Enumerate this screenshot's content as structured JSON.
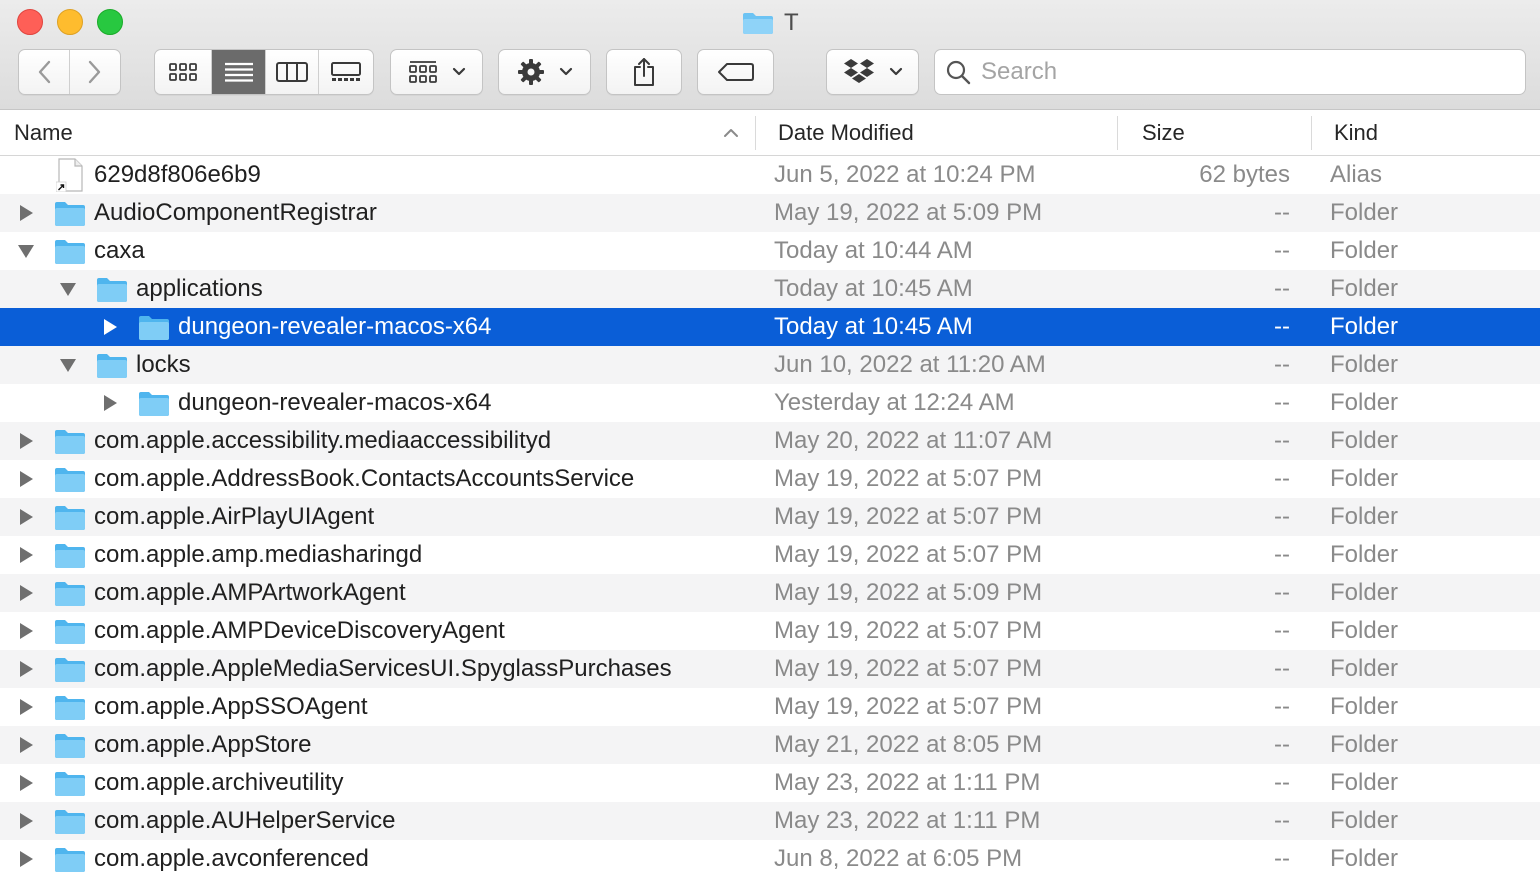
{
  "window": {
    "title": "T",
    "title_icon": "folder-icon"
  },
  "toolbar": {
    "back_icon": "chevron-left-icon",
    "forward_icon": "chevron-right-icon",
    "view_modes": [
      "icon-view-icon",
      "list-view-icon",
      "column-view-icon",
      "gallery-view-icon"
    ],
    "active_view": "list",
    "group_icon": "group-grid-icon",
    "action_icon": "gear-icon",
    "share_icon": "share-icon",
    "tag_icon": "tag-icon",
    "dropbox_icon": "dropbox-icon"
  },
  "search": {
    "placeholder": "Search",
    "value": ""
  },
  "columns": {
    "name": "Name",
    "date": "Date Modified",
    "size": "Size",
    "kind": "Kind",
    "sort": "name-ascending"
  },
  "rows": [
    {
      "name": "629d8f806e6b9",
      "date": "Jun 5, 2022 at 10:24 PM",
      "size": "62 bytes",
      "kind": "Alias",
      "depth": 0,
      "type": "alias",
      "disclosure": "none"
    },
    {
      "name": "AudioComponentRegistrar",
      "date": "May 19, 2022 at 5:09 PM",
      "size": "--",
      "kind": "Folder",
      "depth": 0,
      "type": "folder",
      "disclosure": "collapsed"
    },
    {
      "name": "caxa",
      "date": "Today at 10:44 AM",
      "size": "--",
      "kind": "Folder",
      "depth": 0,
      "type": "folder",
      "disclosure": "expanded"
    },
    {
      "name": "applications",
      "date": "Today at 10:45 AM",
      "size": "--",
      "kind": "Folder",
      "depth": 1,
      "type": "folder",
      "disclosure": "expanded"
    },
    {
      "name": "dungeon-revealer-macos-x64",
      "date": "Today at 10:45 AM",
      "size": "--",
      "kind": "Folder",
      "depth": 2,
      "type": "folder",
      "disclosure": "collapsed",
      "selected": true
    },
    {
      "name": "locks",
      "date": "Jun 10, 2022 at 11:20 AM",
      "size": "--",
      "kind": "Folder",
      "depth": 1,
      "type": "folder",
      "disclosure": "expanded"
    },
    {
      "name": "dungeon-revealer-macos-x64",
      "date": "Yesterday at 12:24 AM",
      "size": "--",
      "kind": "Folder",
      "depth": 2,
      "type": "folder",
      "disclosure": "collapsed"
    },
    {
      "name": "com.apple.accessibility.mediaaccessibilityd",
      "date": "May 20, 2022 at 11:07 AM",
      "size": "--",
      "kind": "Folder",
      "depth": 0,
      "type": "folder",
      "disclosure": "collapsed"
    },
    {
      "name": "com.apple.AddressBook.ContactsAccountsService",
      "date": "May 19, 2022 at 5:07 PM",
      "size": "--",
      "kind": "Folder",
      "depth": 0,
      "type": "folder",
      "disclosure": "collapsed"
    },
    {
      "name": "com.apple.AirPlayUIAgent",
      "date": "May 19, 2022 at 5:07 PM",
      "size": "--",
      "kind": "Folder",
      "depth": 0,
      "type": "folder",
      "disclosure": "collapsed"
    },
    {
      "name": "com.apple.amp.mediasharingd",
      "date": "May 19, 2022 at 5:07 PM",
      "size": "--",
      "kind": "Folder",
      "depth": 0,
      "type": "folder",
      "disclosure": "collapsed"
    },
    {
      "name": "com.apple.AMPArtworkAgent",
      "date": "May 19, 2022 at 5:09 PM",
      "size": "--",
      "kind": "Folder",
      "depth": 0,
      "type": "folder",
      "disclosure": "collapsed"
    },
    {
      "name": "com.apple.AMPDeviceDiscoveryAgent",
      "date": "May 19, 2022 at 5:07 PM",
      "size": "--",
      "kind": "Folder",
      "depth": 0,
      "type": "folder",
      "disclosure": "collapsed"
    },
    {
      "name": "com.apple.AppleMediaServicesUI.SpyglassPurchases",
      "date": "May 19, 2022 at 5:07 PM",
      "size": "--",
      "kind": "Folder",
      "depth": 0,
      "type": "folder",
      "disclosure": "collapsed"
    },
    {
      "name": "com.apple.AppSSOAgent",
      "date": "May 19, 2022 at 5:07 PM",
      "size": "--",
      "kind": "Folder",
      "depth": 0,
      "type": "folder",
      "disclosure": "collapsed"
    },
    {
      "name": "com.apple.AppStore",
      "date": "May 21, 2022 at 8:05 PM",
      "size": "--",
      "kind": "Folder",
      "depth": 0,
      "type": "folder",
      "disclosure": "collapsed"
    },
    {
      "name": "com.apple.archiveutility",
      "date": "May 23, 2022 at 1:11 PM",
      "size": "--",
      "kind": "Folder",
      "depth": 0,
      "type": "folder",
      "disclosure": "collapsed"
    },
    {
      "name": "com.apple.AUHelperService",
      "date": "May 23, 2022 at 1:11 PM",
      "size": "--",
      "kind": "Folder",
      "depth": 0,
      "type": "folder",
      "disclosure": "collapsed"
    },
    {
      "name": "com.apple.avconferenced",
      "date": "Jun 8, 2022 at 6:05 PM",
      "size": "--",
      "kind": "Folder",
      "depth": 0,
      "type": "folder",
      "disclosure": "collapsed"
    }
  ],
  "colors": {
    "selection": "#0a5ed7",
    "folder": "#5ec3f5",
    "stripe": "#f4f4f5",
    "secondary_text": "#8a8a8a"
  }
}
